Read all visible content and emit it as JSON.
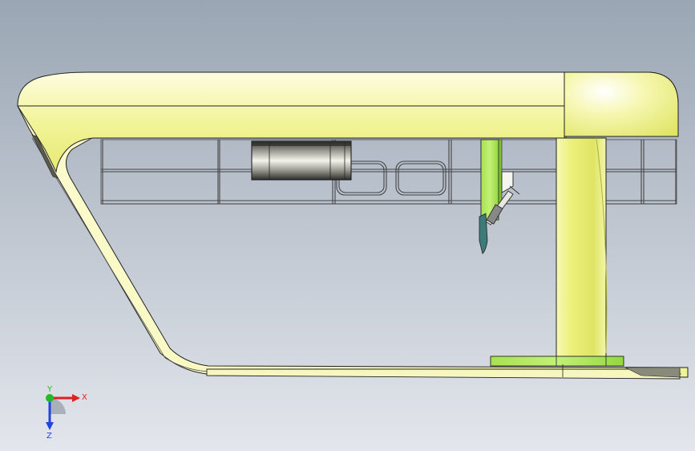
{
  "viewport": {
    "background_top": "#9aa6b4",
    "background_bottom": "#e3e6ec"
  },
  "model": {
    "part_color_light": "#fbfbd0",
    "part_color": "#ecf07c",
    "part_color_dark": "#c9cf52",
    "green_color": "#b4ec5a",
    "green_dark": "#7fbf30",
    "outline_color": "#222222",
    "roller_light": "#e8e8e0",
    "roller_dark": "#3a3a36"
  },
  "triad": {
    "x_label": "X",
    "y_label": "Y",
    "z_label": "Z",
    "x_color": "#dd2222",
    "y_color": "#22bb22",
    "z_color": "#2244dd"
  }
}
